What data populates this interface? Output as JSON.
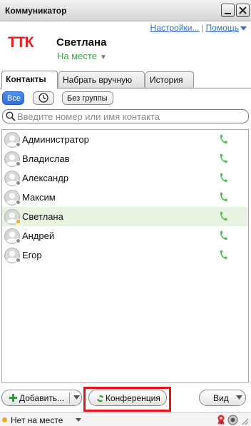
{
  "window": {
    "title": "Коммуникатор"
  },
  "header": {
    "links": {
      "settings": "Настройки...",
      "separator": "|",
      "help": "Помощь"
    },
    "logo_text": "ТТК",
    "user_name": "Светлана",
    "status": "На месте"
  },
  "tabs": [
    {
      "label": "Контакты",
      "active": true
    },
    {
      "label": "Набрать вручную",
      "active": false
    },
    {
      "label": "История",
      "active": false
    }
  ],
  "filters": {
    "all": "Все",
    "no_group": "Без группы"
  },
  "search": {
    "placeholder": "Введите номер или имя контакта",
    "value": ""
  },
  "contacts": [
    {
      "name": "Администратор",
      "status": "offline"
    },
    {
      "name": "Владислав",
      "status": "offline"
    },
    {
      "name": "Александр",
      "status": "offline"
    },
    {
      "name": "Максим",
      "status": "offline"
    },
    {
      "name": "Светлана",
      "status": "away",
      "selected": true
    },
    {
      "name": "Андрей",
      "status": "offline"
    },
    {
      "name": "Егор",
      "status": "offline"
    }
  ],
  "bottom": {
    "add": "Добавить...",
    "conference": "Конференция",
    "view": "Вид"
  },
  "statusbar": {
    "text": "Нет на месте"
  },
  "colors": {
    "accent_green": "#3aa64a",
    "logo_red": "#e31e24",
    "selected_blue": "#2f6edb",
    "highlight_red": "#e8131a",
    "away_orange": "#f2a81e"
  }
}
